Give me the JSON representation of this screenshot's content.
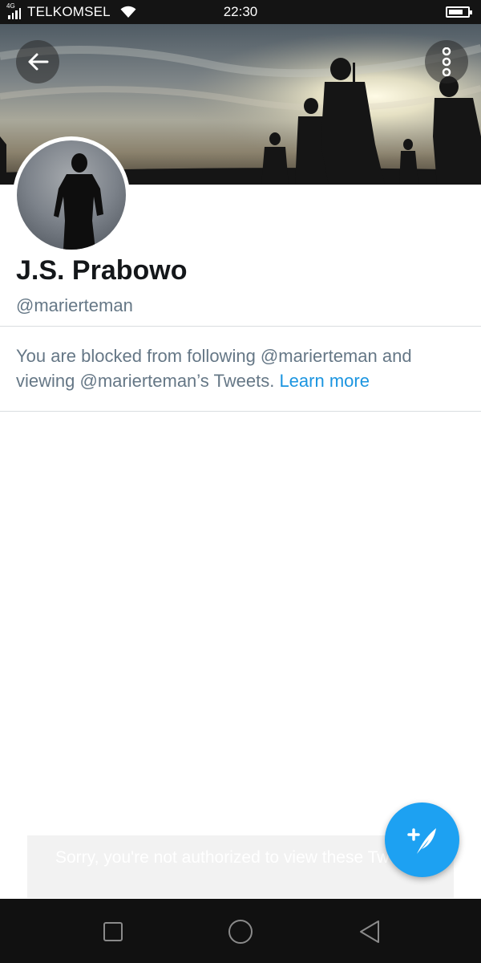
{
  "status_bar": {
    "network": "4G",
    "carrier": "TELKOMSEL",
    "time": "22:30",
    "battery_level": 0.75
  },
  "header": {
    "back_icon": "arrow-left-icon",
    "more_icon": "more-vertical-icon"
  },
  "profile": {
    "name": "J.S. Prabowo",
    "handle": "@marierteman"
  },
  "blocked": {
    "message": "You are blocked from following @marierteman and viewing @marierteman’s Tweets.",
    "link": "Learn more"
  },
  "toast": {
    "text": "Sorry, you're not authorized to view these Tweets."
  },
  "fab": {
    "icon": "compose-tweet-icon"
  },
  "colors": {
    "accent": "#1da1f2",
    "link": "#1b95e0",
    "secondary_text": "#657786"
  }
}
